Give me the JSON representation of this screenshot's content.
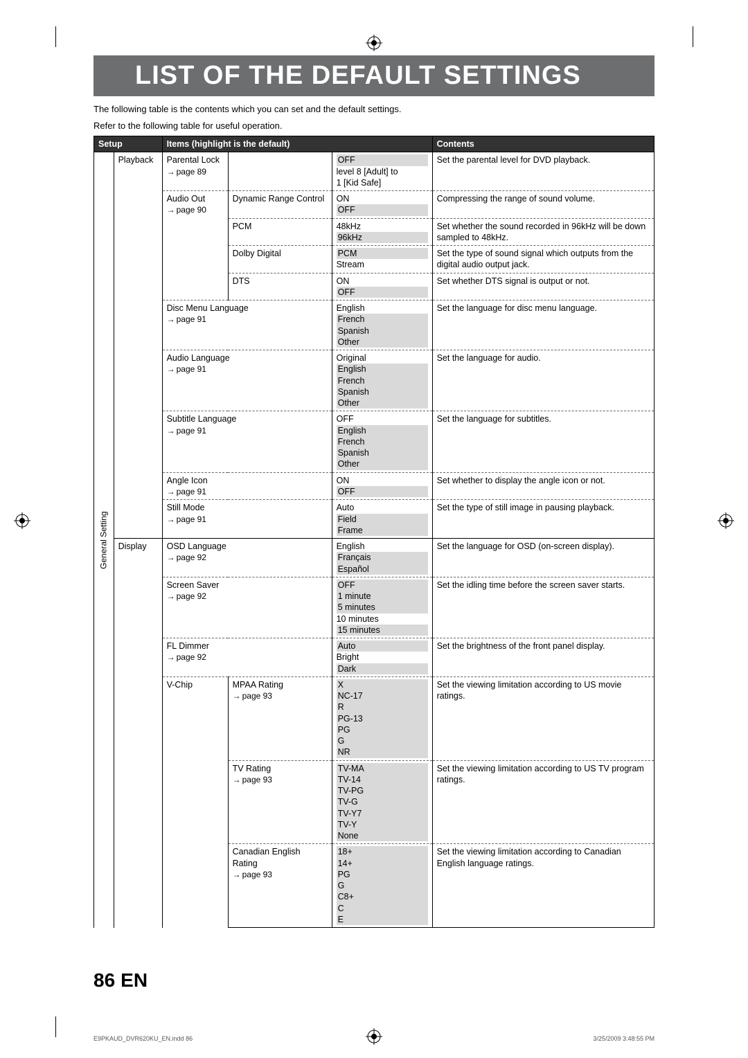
{
  "title": "LIST OF THE DEFAULT SETTINGS",
  "intro_line1": "The following table is the contents which you can set and the default settings.",
  "intro_line2": "Refer to the following table for useful operation.",
  "headers": {
    "setup": "Setup",
    "items": "Items (highlight is the default)",
    "contents": "Contents"
  },
  "rot_label": "General Setting",
  "rows": [
    {
      "section": "Playback",
      "item": "Parental Lock",
      "page": "page 89",
      "sub": "",
      "values": [
        {
          "v": "OFF",
          "hl": true
        },
        {
          "v": "level 8 [Adult] to",
          "hl": false
        },
        {
          "v": "1 [Kid Safe]",
          "hl": false
        }
      ],
      "content": "Set the parental level for DVD playback.",
      "border": "solid",
      "newItem": true
    },
    {
      "item": "Audio Out",
      "page": "page 90",
      "sub": "Dynamic Range Control",
      "values": [
        {
          "v": "ON",
          "hl": false
        },
        {
          "v": "OFF",
          "hl": true
        }
      ],
      "content": "Compressing the range of sound volume.",
      "border": "dashed",
      "newItem": true
    },
    {
      "item": "",
      "page": "",
      "sub": "PCM",
      "values": [
        {
          "v": "48kHz",
          "hl": false
        },
        {
          "v": "96kHz",
          "hl": true
        }
      ],
      "content": "Set whether the sound recorded in 96kHz will be down sampled to 48kHz.",
      "border": "dashed"
    },
    {
      "item": "",
      "page": "",
      "sub": "Dolby Digital",
      "values": [
        {
          "v": "PCM",
          "hl": true
        },
        {
          "v": "Stream",
          "hl": false
        }
      ],
      "content": "Set the type of sound signal which outputs from the digital audio output jack.",
      "border": "dashed"
    },
    {
      "item": "",
      "page": "",
      "sub": "DTS",
      "values": [
        {
          "v": "ON",
          "hl": false
        },
        {
          "v": "OFF",
          "hl": true
        }
      ],
      "content": "Set whether DTS signal is output or not.",
      "border": "dashed"
    },
    {
      "item": "Disc Menu Language",
      "page": "page 91",
      "sub": "",
      "values": [
        {
          "v": "English",
          "hl": false
        },
        {
          "v": "French",
          "hl": true
        },
        {
          "v": "Spanish",
          "hl": true
        },
        {
          "v": "Other",
          "hl": true
        }
      ],
      "content": "Set the language for disc menu language.",
      "border": "dashed",
      "newItem": true,
      "span": 2
    },
    {
      "item": "Audio Language",
      "page": "page 91",
      "sub": "",
      "values": [
        {
          "v": "Original",
          "hl": false
        },
        {
          "v": "English",
          "hl": true
        },
        {
          "v": "French",
          "hl": true
        },
        {
          "v": "Spanish",
          "hl": true
        },
        {
          "v": "Other",
          "hl": true
        }
      ],
      "content": "Set the language for audio.",
      "border": "dashed",
      "newItem": true,
      "span": 2
    },
    {
      "item": "Subtitle Language",
      "page": "page 91",
      "sub": "",
      "values": [
        {
          "v": "OFF",
          "hl": false
        },
        {
          "v": "English",
          "hl": true
        },
        {
          "v": "French",
          "hl": true
        },
        {
          "v": "Spanish",
          "hl": true
        },
        {
          "v": "Other",
          "hl": true
        }
      ],
      "content": "Set the language for subtitles.",
      "border": "dashed",
      "newItem": true,
      "span": 2
    },
    {
      "item": "Angle Icon",
      "page": "page 91",
      "sub": "",
      "values": [
        {
          "v": "ON",
          "hl": false
        },
        {
          "v": "OFF",
          "hl": true
        }
      ],
      "content": "Set whether to display the angle icon or not.",
      "border": "dashed",
      "newItem": true,
      "span": 2
    },
    {
      "item": "Still Mode",
      "page": "page 91",
      "sub": "",
      "values": [
        {
          "v": "Auto",
          "hl": false
        },
        {
          "v": "Field",
          "hl": true
        },
        {
          "v": "Frame",
          "hl": true
        }
      ],
      "content": "Set the type of still image in pausing playback.",
      "border": "dashed",
      "newItem": true,
      "span": 2
    },
    {
      "section": "Display",
      "item": "OSD Language",
      "page": "page 92",
      "sub": "",
      "values": [
        {
          "v": "English",
          "hl": false
        },
        {
          "v": "Français",
          "hl": true
        },
        {
          "v": "Español",
          "hl": true
        }
      ],
      "content": "Set the language for OSD (on-screen display).",
      "border": "solid",
      "newItem": true,
      "span": 2
    },
    {
      "item": "Screen Saver",
      "page": "page 92",
      "sub": "",
      "values": [
        {
          "v": "OFF",
          "hl": true
        },
        {
          "v": "1 minute",
          "hl": true
        },
        {
          "v": "5 minutes",
          "hl": true
        },
        {
          "v": "10 minutes",
          "hl": false
        },
        {
          "v": "15 minutes",
          "hl": true
        }
      ],
      "content": "Set the idling time before the screen saver starts.",
      "border": "dashed",
      "newItem": true,
      "span": 2
    },
    {
      "item": "FL Dimmer",
      "page": "page 92",
      "sub": "",
      "values": [
        {
          "v": "Auto",
          "hl": true
        },
        {
          "v": "Bright",
          "hl": false
        },
        {
          "v": "Dark",
          "hl": true
        }
      ],
      "content": "Set the brightness of the front panel display.",
      "border": "dashed",
      "newItem": true,
      "span": 2
    },
    {
      "item": "V-Chip",
      "page": "",
      "sub": "MPAA Rating",
      "subpage": "page 93",
      "values": [
        {
          "v": "X",
          "hl": true
        },
        {
          "v": "NC-17",
          "hl": true
        },
        {
          "v": "R",
          "hl": true
        },
        {
          "v": "PG-13",
          "hl": true
        },
        {
          "v": "PG",
          "hl": true
        },
        {
          "v": "G",
          "hl": true
        },
        {
          "v": "NR",
          "hl": true
        }
      ],
      "content": "Set the viewing limitation according to US movie ratings.",
      "border": "dashed",
      "newItem": true
    },
    {
      "item": "",
      "page": "",
      "sub": "TV Rating",
      "subpage": "page 93",
      "values": [
        {
          "v": "TV-MA",
          "hl": true
        },
        {
          "v": "TV-14",
          "hl": true
        },
        {
          "v": "TV-PG",
          "hl": true
        },
        {
          "v": "TV-G",
          "hl": true
        },
        {
          "v": "TV-Y7",
          "hl": true
        },
        {
          "v": "TV-Y",
          "hl": true
        },
        {
          "v": "None",
          "hl": true
        }
      ],
      "content": "Set the viewing limitation according to US TV program ratings.",
      "border": "dashed"
    },
    {
      "item": "",
      "page": "",
      "sub": "Canadian English Rating",
      "subpage": "page 93",
      "values": [
        {
          "v": "18+",
          "hl": true
        },
        {
          "v": "14+",
          "hl": true
        },
        {
          "v": "PG",
          "hl": true
        },
        {
          "v": "G",
          "hl": true
        },
        {
          "v": "C8+",
          "hl": true
        },
        {
          "v": "C",
          "hl": true
        },
        {
          "v": "E",
          "hl": true
        }
      ],
      "content": "Set the viewing limitation according to Canadian English language ratings.",
      "border": "dashed",
      "last": true
    }
  ],
  "page_number": "86",
  "page_lang": "EN",
  "footer_left": "E9PKAUD_DVR620KU_EN.indd   86",
  "footer_right": "3/25/2009   3:48:55 PM"
}
